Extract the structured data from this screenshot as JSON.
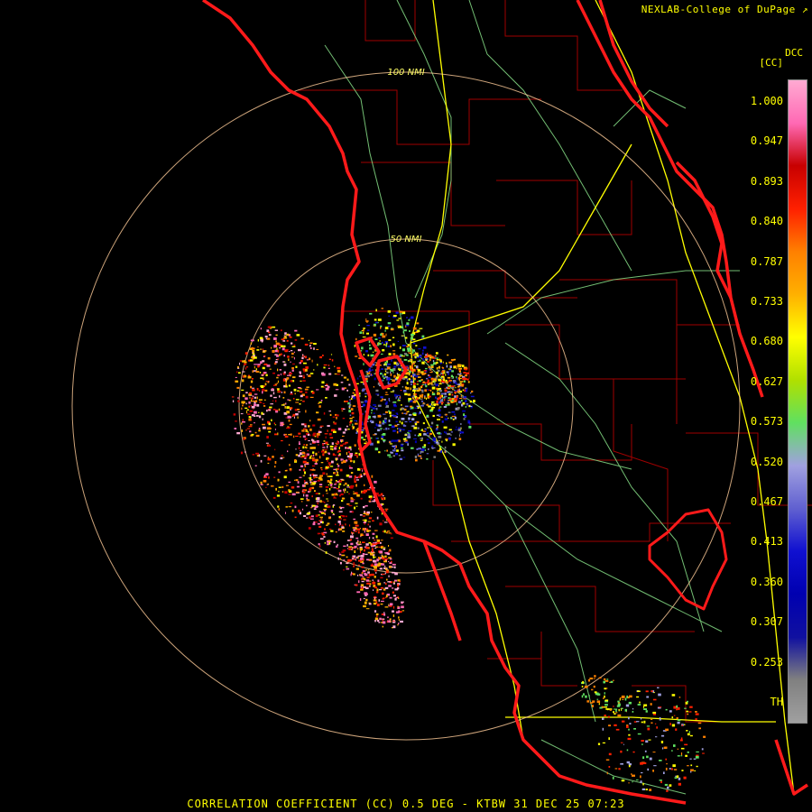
{
  "header": {
    "credit": "NEXLAB-College of DuPage",
    "credit_icon": "arrow-logo-icon"
  },
  "footer": {
    "product": "CORRELATION COEFFICIENT (CC) 0.5 DEG - KTBW 31 DEC 25 07:23"
  },
  "map": {
    "radar_site": "KTBW",
    "range_rings": [
      {
        "label": "50 NMI",
        "nmi": 50
      },
      {
        "label": "100 NMI",
        "nmi": 100
      }
    ],
    "colors": {
      "coast": "#ff1a1a",
      "county": "#a00000",
      "highway_major": "#ffff00",
      "highway_minor": "#90ee90",
      "ring": "#ffcc99"
    }
  },
  "legend": {
    "title": "DCC",
    "unit": "[CC]",
    "ticks": [
      "1.000",
      "0.947",
      "0.893",
      "0.840",
      "0.787",
      "0.733",
      "0.680",
      "0.627",
      "0.573",
      "0.520",
      "0.467",
      "0.413",
      "0.360",
      "0.307",
      "0.253",
      "TH"
    ],
    "stops": [
      "#ffaad2",
      "#ff69b4",
      "#c80000",
      "#ff2000",
      "#ff8000",
      "#ffb000",
      "#ffff00",
      "#b0e000",
      "#60e060",
      "#a0a0e0",
      "#6060d0",
      "#1010d0",
      "#0000b0",
      "#1010a0",
      "#808080",
      "#a0a0a0"
    ]
  }
}
